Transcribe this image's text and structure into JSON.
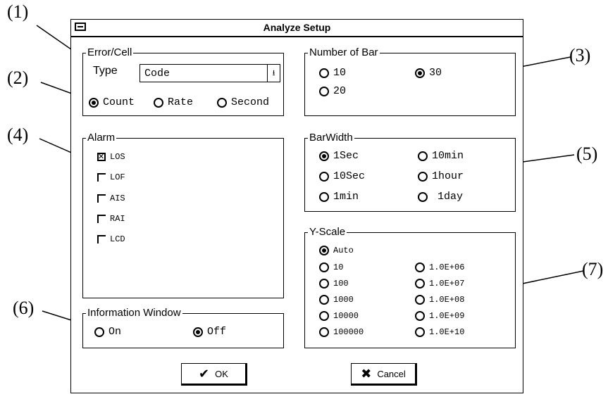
{
  "callouts": [
    "(1)",
    "(2)",
    "(3)",
    "(4)",
    "(5)",
    "(6)",
    "(7)"
  ],
  "dialog": {
    "title": "Analyze Setup"
  },
  "error_cell": {
    "legend": "Error/Cell",
    "type_label": "Type",
    "type_value": "Code",
    "combo_icon": "dropdown-arrow-icon",
    "options": [
      "Count",
      "Rate",
      "Second"
    ],
    "selected": "Count"
  },
  "number_of_bar": {
    "legend": "Number of Bar",
    "options": [
      "10",
      "30",
      "20"
    ],
    "selected": "30"
  },
  "alarm": {
    "legend": "Alarm",
    "items": [
      {
        "label": "LOS",
        "checked": true
      },
      {
        "label": "LOF",
        "checked": false
      },
      {
        "label": "AIS",
        "checked": false
      },
      {
        "label": "RAI",
        "checked": false
      },
      {
        "label": "LCD",
        "checked": false
      }
    ]
  },
  "bar_width": {
    "legend": "BarWidth",
    "options": [
      "1Sec",
      "10min",
      "10Sec",
      "1hour",
      "1min",
      "1day"
    ],
    "selected": "1Sec"
  },
  "y_scale": {
    "legend": "Y-Scale",
    "options": [
      "Auto",
      "10",
      "1.0E+06",
      "100",
      "1.0E+07",
      "1000",
      "1.0E+08",
      "10000",
      "1.0E+09",
      "100000",
      "1.0E+10"
    ],
    "selected": "Auto"
  },
  "info_window": {
    "legend": "Information Window",
    "options": [
      "On",
      "Off"
    ],
    "selected": "Off"
  },
  "buttons": {
    "ok": {
      "label": "OK",
      "icon": "checkmark-icon"
    },
    "cancel": {
      "label": "Cancel",
      "icon": "x-mark-icon"
    }
  }
}
